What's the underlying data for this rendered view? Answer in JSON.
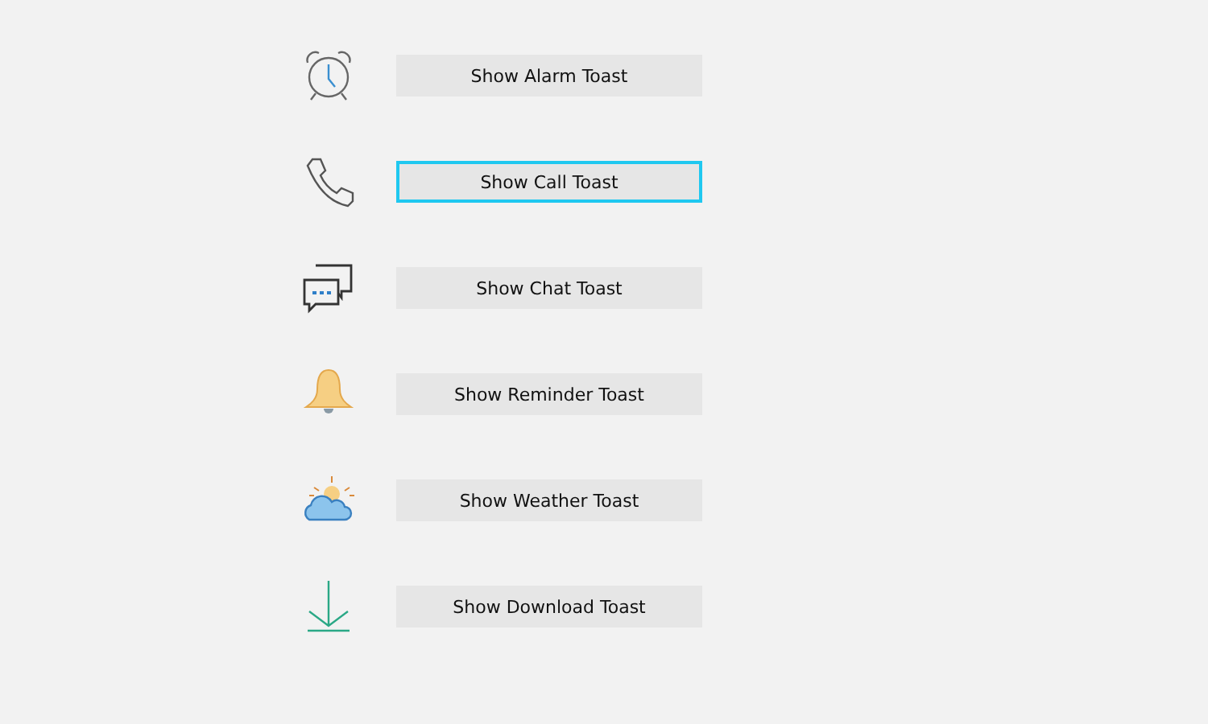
{
  "buttons": [
    {
      "kind": "alarm",
      "label": "Show Alarm Toast",
      "focused": false
    },
    {
      "kind": "call",
      "label": "Show Call Toast",
      "focused": true
    },
    {
      "kind": "chat",
      "label": "Show Chat Toast",
      "focused": false
    },
    {
      "kind": "reminder",
      "label": "Show Reminder Toast",
      "focused": false
    },
    {
      "kind": "weather",
      "label": "Show Weather Toast",
      "focused": false
    },
    {
      "kind": "download",
      "label": "Show Download Toast",
      "focused": false
    }
  ]
}
